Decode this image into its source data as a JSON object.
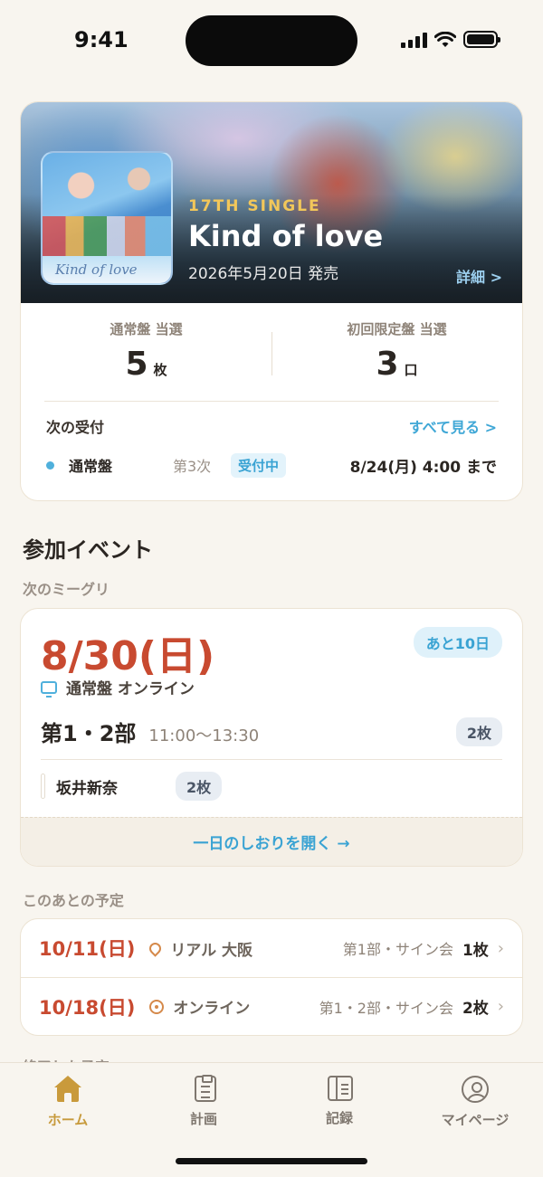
{
  "status_bar": {
    "time": "9:41"
  },
  "release": {
    "single_label": "17TH SINGLE",
    "title": "Kind of love",
    "release_date": "2026年5月20日 発売",
    "detail_link": "詳細 >",
    "jacket_logo": "Kind of love",
    "counts": [
      {
        "label": "通常盤 当選",
        "value": "5",
        "unit": "枚"
      },
      {
        "label": "初回限定盤 当選",
        "value": "3",
        "unit": "口"
      }
    ],
    "next_reception": {
      "heading": "次の受付",
      "see_all": "すべて見る >",
      "type": "通常盤",
      "round": "第3次",
      "status": "受付中",
      "deadline": "8/24(月) 4:00 まで"
    }
  },
  "events": {
    "section_title": "参加イベント",
    "next_label": "次のミーグリ",
    "next": {
      "date": "8/30(日)",
      "days_left": "あと10日",
      "kind": "通常盤 オンライン",
      "part": "第1・2部",
      "time": "11:00〜13:30",
      "tickets": "2枚",
      "member": "坂井新奈",
      "member_tickets": "2枚",
      "footer_link": "一日のしおりを開く →"
    },
    "upcoming_label": "このあとの予定",
    "upcoming": [
      {
        "date": "10/11(日)",
        "icon": "location-pin-icon",
        "place": "リアル 大阪",
        "detail": "第1部・サイン会",
        "count": "1枚"
      },
      {
        "date": "10/18(日)",
        "icon": "disc-icon",
        "place": "オンライン",
        "detail": "第1・2部・サイン会",
        "count": "2枚"
      }
    ],
    "partial_label": "終了した予定"
  },
  "tab_bar": {
    "tabs": [
      {
        "label": "ホーム",
        "icon": "home-icon",
        "active": true
      },
      {
        "label": "計画",
        "icon": "clipboard-icon",
        "active": false
      },
      {
        "label": "記録",
        "icon": "notebook-icon",
        "active": false
      },
      {
        "label": "マイページ",
        "icon": "user-icon",
        "active": false
      }
    ],
    "accent_color": "#c79a3c"
  },
  "colors": {
    "date_red": "#c84a30",
    "link_blue": "#3aa3d3",
    "background": "#f8f5ef"
  }
}
